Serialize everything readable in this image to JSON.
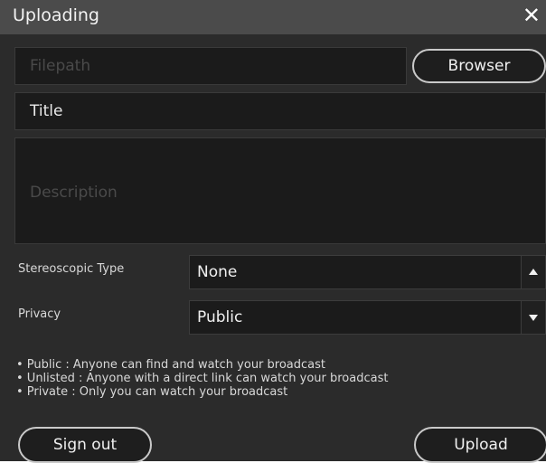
{
  "dialog": {
    "title": "Uploading",
    "close_glyph": "✕"
  },
  "form": {
    "filepath_placeholder": "Filepath",
    "browse_label": "Browser",
    "title_value": "Title",
    "description_placeholder": "Description",
    "stereoscopic_label": "Stereoscopic Type",
    "stereoscopic_value": "None",
    "privacy_label": "Privacy",
    "privacy_value": "Public"
  },
  "privacy_help": [
    "• Public : Anyone can find and watch your broadcast",
    "• Unlisted : Anyone with a direct link can watch your broadcast",
    "• Private : Only you can watch your broadcast"
  ],
  "actions": {
    "signout_label": "Sign out",
    "upload_label": "Upload"
  },
  "icons": {
    "close": "close-icon",
    "stereo_arrow": "chevron-up-icon",
    "privacy_arrow": "chevron-down-icon"
  },
  "colors": {
    "background": "#2b2b2b",
    "titlebar": "#4b4b4b",
    "field": "#1b1b1b",
    "button_border": "#c9c9c9"
  }
}
